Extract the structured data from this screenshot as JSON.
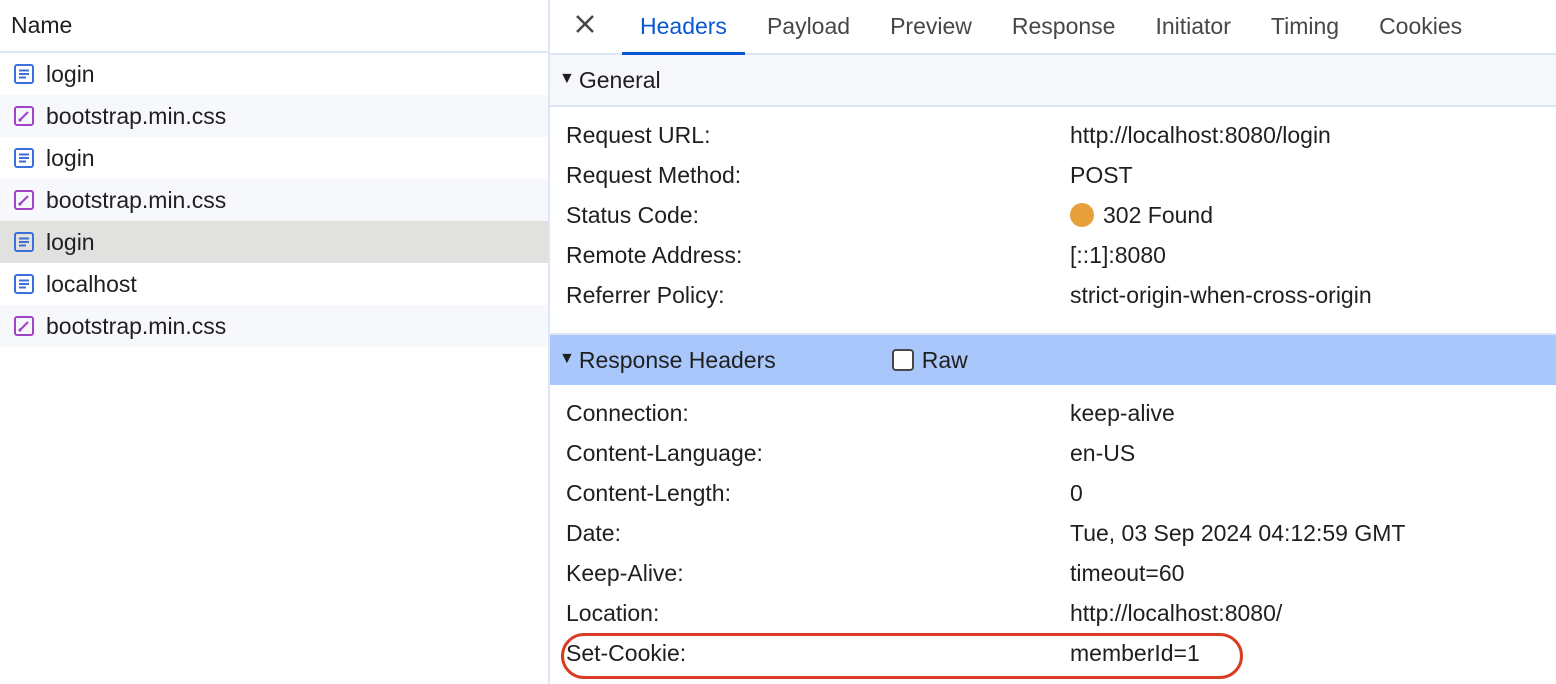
{
  "requests": {
    "header": "Name",
    "items": [
      {
        "name": "login",
        "type": "document"
      },
      {
        "name": "bootstrap.min.css",
        "type": "stylesheet"
      },
      {
        "name": "login",
        "type": "document"
      },
      {
        "name": "bootstrap.min.css",
        "type": "stylesheet"
      },
      {
        "name": "login",
        "type": "document",
        "selected": true
      },
      {
        "name": "localhost",
        "type": "document"
      },
      {
        "name": "bootstrap.min.css",
        "type": "stylesheet"
      }
    ]
  },
  "tabs": {
    "close_icon": "close-icon",
    "items": [
      "Headers",
      "Payload",
      "Preview",
      "Response",
      "Initiator",
      "Timing",
      "Cookies"
    ],
    "active": "Headers"
  },
  "general": {
    "title": "General",
    "rows": [
      {
        "key": "Request URL:",
        "value": "http://localhost:8080/login"
      },
      {
        "key": "Request Method:",
        "value": "POST"
      },
      {
        "key": "Status Code:",
        "value": "302 Found"
      },
      {
        "key": "Remote Address:",
        "value": "[::1]:8080"
      },
      {
        "key": "Referrer Policy:",
        "value": "strict-origin-when-cross-origin"
      }
    ]
  },
  "response_headers": {
    "title": "Response Headers",
    "raw_label": "Raw",
    "raw_checked": false,
    "rows": [
      {
        "key": "Connection:",
        "value": "keep-alive"
      },
      {
        "key": "Content-Language:",
        "value": "en-US"
      },
      {
        "key": "Content-Length:",
        "value": "0"
      },
      {
        "key": "Date:",
        "value": "Tue, 03 Sep 2024 04:12:59 GMT"
      },
      {
        "key": "Keep-Alive:",
        "value": "timeout=60"
      },
      {
        "key": "Location:",
        "value": "http://localhost:8080/"
      },
      {
        "key": "Set-Cookie:",
        "value": "memberId=1",
        "highlighted": true
      }
    ]
  },
  "colors": {
    "accent": "#0b57d0",
    "status_redirect": "#e8a13a",
    "highlight_outline": "#d93b23",
    "document_icon": "#3b6fd9",
    "stylesheet_icon": "#a142c9"
  }
}
